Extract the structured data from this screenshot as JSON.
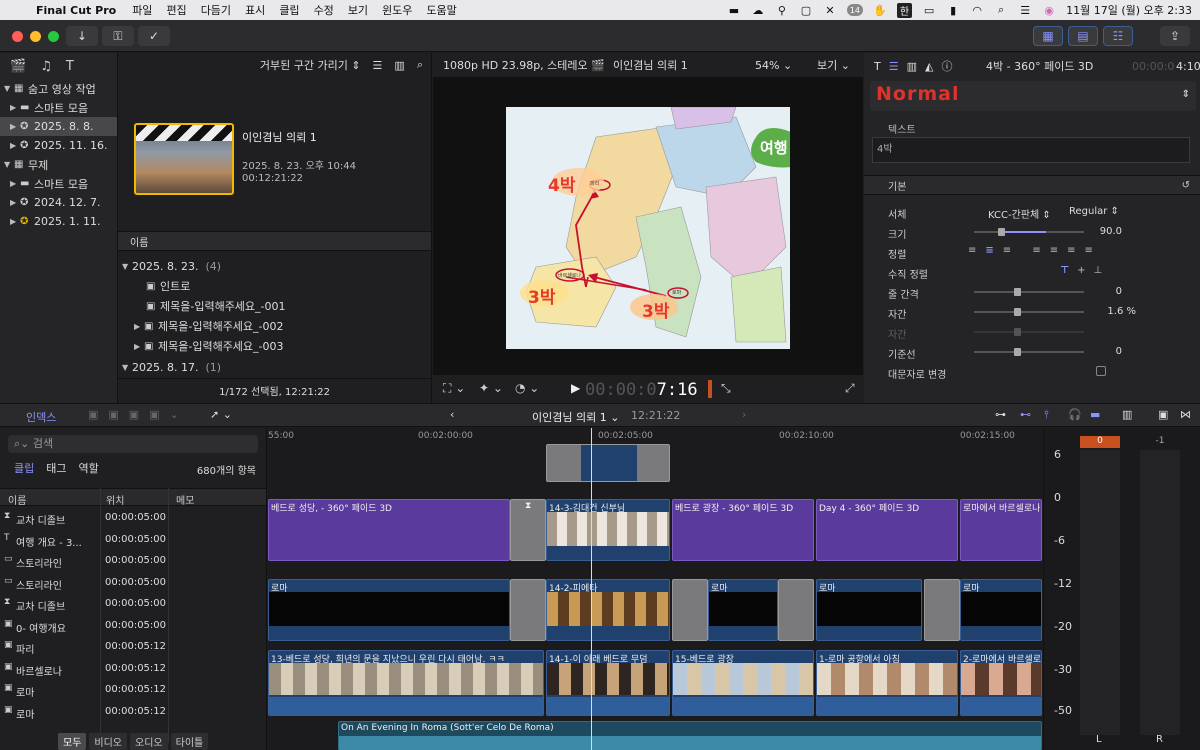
{
  "menubar": {
    "app": "Final Cut Pro",
    "items": [
      "파일",
      "편집",
      "다듬기",
      "표시",
      "클립",
      "수정",
      "보기",
      "윈도우",
      "도움말"
    ],
    "input_mode": "한",
    "clock": "11월 17일 (월) 오후 2:33",
    "badge": "14"
  },
  "library": {
    "rows": [
      {
        "label": "숨고 영상 작업",
        "level": 0,
        "type": "library",
        "open": true
      },
      {
        "label": "스마트 모음",
        "level": 1,
        "type": "folder",
        "open": false
      },
      {
        "label": "2025. 8. 8.",
        "level": 1,
        "type": "event",
        "open": false,
        "selected": true
      },
      {
        "label": "2025. 11. 16.",
        "level": 1,
        "type": "event",
        "open": false
      },
      {
        "label": "무제",
        "level": 0,
        "type": "library",
        "open": true
      },
      {
        "label": "스마트 모음",
        "level": 1,
        "type": "folder",
        "open": false
      },
      {
        "label": "2024. 12. 7.",
        "level": 1,
        "type": "event",
        "open": false
      },
      {
        "label": "2025. 1. 11.",
        "level": 1,
        "type": "event",
        "open": false
      }
    ]
  },
  "browser": {
    "filter_label": "거부된 구간 가리기",
    "clip_title": "이인겸님 의뢰 1",
    "clip_date": "2025. 8. 23. 오후 10:44",
    "clip_length": "00:12:21:22",
    "list_header": "이름",
    "groups": [
      {
        "label": "2025. 8. 23.",
        "count": "(4)"
      },
      {
        "label": "2025. 8. 17.",
        "count": "(1)"
      }
    ],
    "items": [
      {
        "label": "인트로",
        "expand": false
      },
      {
        "label": "제목을-입력해주세요_-001",
        "expand": false
      },
      {
        "label": "제목을-입력해주세요_-002",
        "expand": true
      },
      {
        "label": "제목을-입력해주세요_-003",
        "expand": true
      }
    ],
    "status": "1/172 선택됨, 12:21:22"
  },
  "viewer": {
    "format": "1080p HD 23.98p, 스테레오",
    "project": "이인겸님 의뢰 1",
    "zoom": "54%",
    "view_label": "보기",
    "timecode_dim": "00:00:0",
    "timecode_bright": "7:16",
    "frame_labels": {
      "left": "4박",
      "bottom_left": "3박",
      "bottom_right": "3박",
      "badge": "여행 개요",
      "circle1": "파리",
      "circle2": "바르셀로나",
      "circle3": "로마"
    }
  },
  "inspector": {
    "title": "4박 - 360° 페이드 3D",
    "duration": "4:10",
    "duration_dim": "00:00:0",
    "style": "Normal",
    "text_label": "텍스트",
    "text_value": "4박",
    "section": "기본",
    "rows": [
      {
        "label": "서체",
        "value": "KCC-간판체",
        "value2": "Regular"
      },
      {
        "label": "크기",
        "value": "90.0",
        "slider": 0.25
      },
      {
        "label": "정렬",
        "value": ""
      },
      {
        "label": "수직 정렬",
        "value": ""
      },
      {
        "label": "줄 간격",
        "value": "0",
        "slider": 0.5
      },
      {
        "label": "자간",
        "value": "1.6  %",
        "slider": 0.5
      },
      {
        "label": "자간",
        "value": "",
        "slider": 0.5,
        "dim": true
      },
      {
        "label": "기준선",
        "value": "0",
        "slider": 0.5
      },
      {
        "label": "대문자로 변경",
        "value": ""
      }
    ]
  },
  "timeline_bar": {
    "index_label": "인덱스",
    "project": "이인겸님 의뢰 1",
    "duration": "12:21:22"
  },
  "index": {
    "search_placeholder": "검색",
    "tabs": [
      "클립",
      "태그",
      "역할"
    ],
    "count": "680개의 항목",
    "headers": [
      "이름",
      "위치",
      "메모"
    ],
    "rows": [
      {
        "icon": "⧗",
        "name": "교차 디졸브",
        "pos": "00:00:05:00"
      },
      {
        "icon": "T",
        "name": "여행 개요 - 3...",
        "pos": "00:00:05:00"
      },
      {
        "icon": "▭",
        "name": "스토리라인",
        "pos": "00:00:05:00"
      },
      {
        "icon": "▭",
        "name": "스토리라인",
        "pos": "00:00:05:00"
      },
      {
        "icon": "⧗",
        "name": "교차 디졸브",
        "pos": "00:00:05:00"
      },
      {
        "icon": "▣",
        "name": "0- 여행개요",
        "pos": "00:00:05:00"
      },
      {
        "icon": "▣",
        "name": "파리",
        "pos": "00:00:05:12"
      },
      {
        "icon": "▣",
        "name": "바르셀로나",
        "pos": "00:00:05:12"
      },
      {
        "icon": "▣",
        "name": "로마",
        "pos": "00:00:05:12"
      },
      {
        "icon": "▣",
        "name": "로마",
        "pos": "00:00:05:12"
      }
    ],
    "bottom_tabs": [
      "모두",
      "비디오",
      "오디오",
      "타이틀"
    ]
  },
  "timeline": {
    "ruler": [
      "55:00",
      "00:02:00:00",
      "00:02:05:00",
      "00:02:10:00",
      "00:02:15:00"
    ],
    "titles": [
      "베드로 성당, - 360° 페이드 3D",
      "14-3-김대건 신부님",
      "베드로 광장 - 360° 페이드 3D",
      "Day 4 - 360° 페이드 3D",
      "로마에서 바르셀로나"
    ],
    "b_roll": [
      "로마",
      "14-2-피에타",
      "로마",
      "로마",
      "로마"
    ],
    "primary": [
      "13-베드로 성당, 희년의 문을 지났으니 우린 다시 태어남. ㅋㅋ",
      "14-1-이 아래 베드로 무덤",
      "15-베드로 광장",
      "1-로마 공항에서 아침",
      "2-로마에서 바르셀로나"
    ],
    "music": "On An Evening In Roma (Sott'er Celo De Roma)"
  },
  "meter": {
    "peak_l": "0",
    "peak_r": "-1",
    "ticks": [
      "6",
      "0",
      "-6",
      "-12",
      "-20",
      "-30",
      "-50"
    ],
    "left": "L",
    "right": "R"
  },
  "colors": {
    "accent": "#8b93ff",
    "title_clip": "#5b3a9e",
    "video_clip": "#20406e",
    "style_red": "#e0322b",
    "selection_yellow": "#f2b800"
  }
}
